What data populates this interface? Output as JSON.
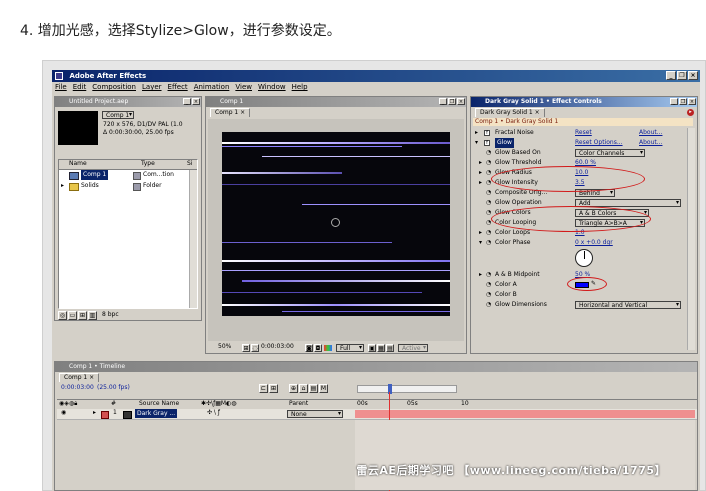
{
  "caption": "4. 增加光感，选择Stylize>Glow，进行参数设定。",
  "app": {
    "title": "Adobe After Effects",
    "menu": [
      "File",
      "Edit",
      "Composition",
      "Layer",
      "Effect",
      "Animation",
      "View",
      "Window",
      "Help"
    ]
  },
  "project": {
    "title": "Untitled Project.aep",
    "comp_dropdown": "Comp 1",
    "info_line1": "720 x 576, D1/DV PAL (1.0",
    "info_line2": "Δ 0:00:30:00, 25.00 fps",
    "col_name": "Name",
    "col_type": "Type",
    "col_size": "Si",
    "items": [
      {
        "name": "Comp 1",
        "type": "Com...tion",
        "selected": true
      },
      {
        "name": "Solids",
        "type": "Folder",
        "selected": false
      }
    ],
    "bpc": "8 bpc"
  },
  "comp": {
    "title": "Comp 1",
    "tab": "Comp 1",
    "zoom": "50%",
    "timecode": "0:00:03:00",
    "resolution": "Full",
    "active_label": "Active"
  },
  "effects": {
    "title": "Dark Gray Solid 1 • Effect Controls",
    "tab": "Dark Gray Solid 1",
    "path": "Comp 1 • Dark Gray Solid 1",
    "reset": "Reset",
    "about": "About...",
    "reset_options": "Reset Options...",
    "rows": [
      {
        "label": "Fractal Noise",
        "kind": "effect"
      },
      {
        "label": "Glow",
        "kind": "effect-selected"
      },
      {
        "label": "Glow Based On",
        "value": "Color Channels",
        "kind": "dropdown"
      },
      {
        "label": "Glow Threshold",
        "value": "60.0 %",
        "kind": "value"
      },
      {
        "label": "Glow Radius",
        "value": "10.0",
        "kind": "value"
      },
      {
        "label": "Glow Intensity",
        "value": "3.5",
        "kind": "value"
      },
      {
        "label": "Composite Orig...",
        "value": "Behind",
        "kind": "dropdown"
      },
      {
        "label": "Glow Operation",
        "value": "Add",
        "kind": "dropdown-wide"
      },
      {
        "label": "Glow Colors",
        "value": "A & B Colors",
        "kind": "dropdown"
      },
      {
        "label": "Color Looping",
        "value": "Triangle A>B>A",
        "kind": "dropdown"
      },
      {
        "label": "Color Loops",
        "value": "1.0",
        "kind": "value"
      },
      {
        "label": "Color Phase",
        "value": "0 x +0.0 dgr",
        "kind": "value"
      },
      {
        "label": "A & B Midpoint",
        "value": "50 %",
        "kind": "value"
      },
      {
        "label": "Color A",
        "kind": "color",
        "color": "#0000ff"
      },
      {
        "label": "Color B",
        "kind": "color-none"
      },
      {
        "label": "Glow Dimensions",
        "value": "Horizontal and Vertical",
        "kind": "dropdown-wide"
      }
    ]
  },
  "timeline": {
    "title": "Comp 1 • Timeline",
    "tab": "Comp 1",
    "timecode": "0:00:03:00",
    "fps": "(25.00 fps)",
    "col_num": "#",
    "col_source": "Source Name",
    "col_parent": "Parent",
    "layer_num": "1",
    "layer_name": "Dark Gray ...",
    "parent_value": "None",
    "ruler": [
      "00s",
      "05s",
      "10"
    ]
  },
  "watermark": "雷云AE后期学习吧  【www.lineeg.com/tieba/1775】",
  "colors": {
    "accent": "#0a246a",
    "annotation": "#d21a1a",
    "color_a": "#0000ff"
  }
}
